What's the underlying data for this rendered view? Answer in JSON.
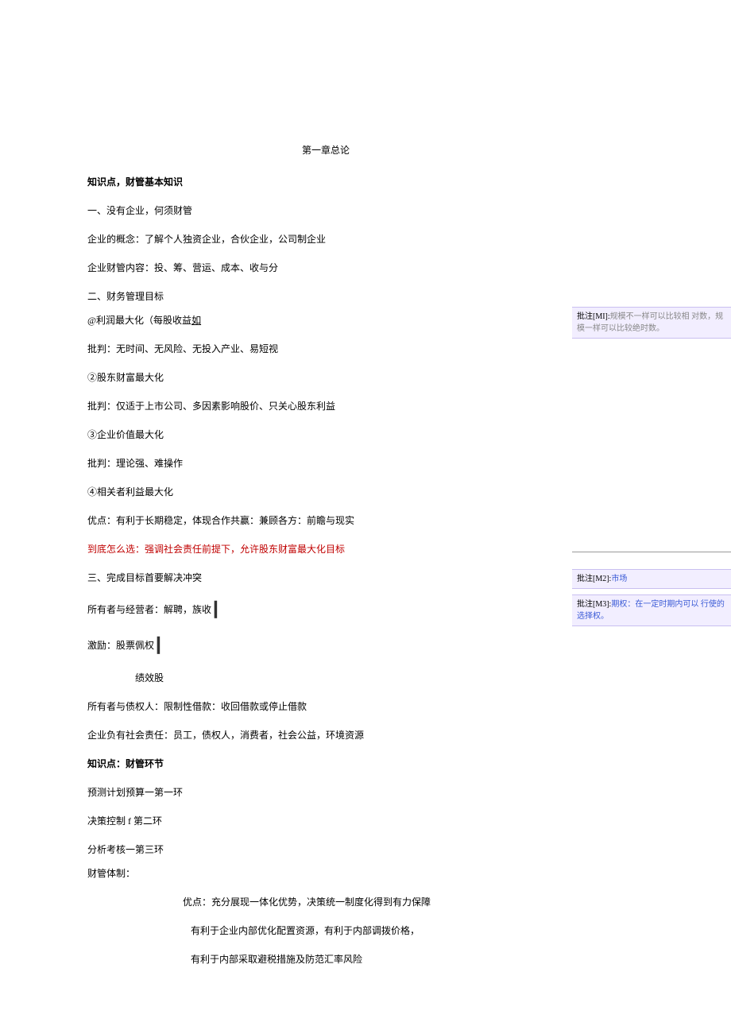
{
  "title": "第一章总论",
  "h1": "知识点，财管基本知识",
  "p1": "一、没有企业，何须财管",
  "p2": "企业的概念：了解个人独资企业，合伙企业，公司制企业",
  "p3": "企业财管内容：投、筹、营运、成本、收与分",
  "p4": "二、财务管理目标",
  "p5a": "@利润最大化（每股收益",
  "p5b": "如",
  "p6": "批判：无时间、无风险、无投入产业、易短视",
  "p7": "②股东财富最大化",
  "p8": "批判：仅适于上市公司、多因素影响股价、只关心股东利益",
  "p9": "③企业价值最大化",
  "p10": "批判：理论强、难操作",
  "p11": "④相关者利益最大化",
  "p12": "优点：有利于长期稳定，体现合作共赢：兼顾各方：前瞻与现实",
  "p13": "到底怎么选：强调社会责任前提下，允许股东财富最大化目标",
  "p14": "三、完成目标首要解决冲突",
  "p15": "所有者与经营者：解聘，族收",
  "p16": "激励：股票佩权",
  "p17": "绩效股",
  "p18": "所有者与债权人：限制性借款：收回借款或停止借款",
  "p19": "企业负有社会责任：员工，债权人，消费者，社会公益，环境资源",
  "h2": "知识点：财管环节",
  "p20": "预测计划预算一第一环",
  "p21": "决策控制 f 第二环",
  "p22": "分析考核一第三环",
  "p23": "财管体制：",
  "p24": "优点：充分展现一体化优势，决策统一制度化得到有力保障",
  "p25": "有利于企业内部优化配置资源，有利于内部调拨价格，",
  "p26": "有利于内部采取避税措施及防范汇率风险",
  "comments": {
    "c1": {
      "tag": "批注[MI]:",
      "text": "规模不一样可以比较相 对数，规模一样可以比较绝时数。"
    },
    "c2": {
      "tag": "批注[M2]:",
      "text": "市场"
    },
    "c3": {
      "tag": "批注[M3]:",
      "text": "期权：在一定时期内可以 行使的选择权。"
    }
  }
}
